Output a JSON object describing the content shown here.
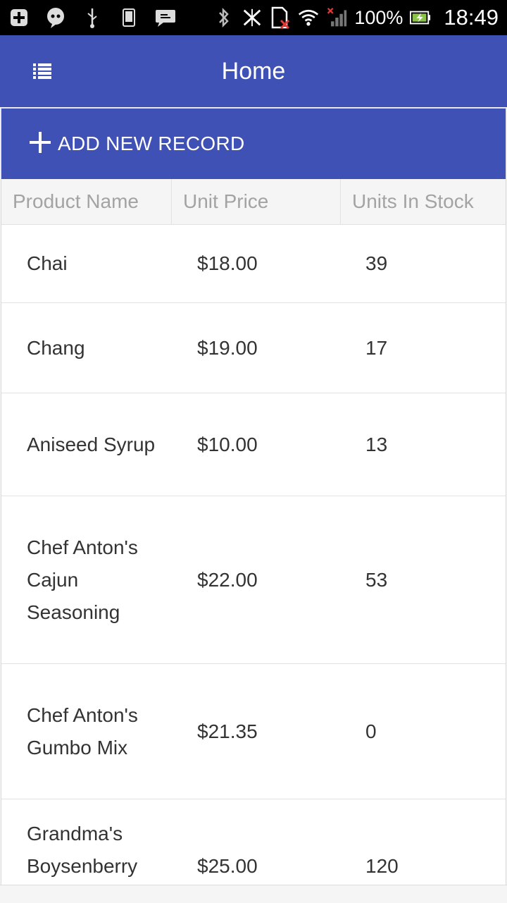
{
  "status_bar": {
    "battery": "100%",
    "time": "18:49",
    "icons": [
      "add-icon",
      "chat-icon",
      "usb-icon",
      "phone-icon",
      "message-icon",
      "bluetooth-icon",
      "signal-off-icon",
      "sim-error-icon",
      "wifi-icon",
      "cell-signal-icon",
      "battery-icon"
    ]
  },
  "app_bar": {
    "title": "Home",
    "menu_icon": "list-icon"
  },
  "toolbar": {
    "add_label": "ADD NEW RECORD"
  },
  "table": {
    "columns": [
      "Product Name",
      "Unit Price",
      "Units In Stock"
    ],
    "rows": [
      {
        "name": "Chai",
        "price": "$18.00",
        "stock": "39"
      },
      {
        "name": "Chang",
        "price": "$19.00",
        "stock": "17"
      },
      {
        "name": "Aniseed Syrup",
        "price": "$10.00",
        "stock": "13"
      },
      {
        "name": "Chef Anton's Cajun Seasoning",
        "price": "$22.00",
        "stock": "53"
      },
      {
        "name": "Chef Anton's Gumbo Mix",
        "price": "$21.35",
        "stock": "0"
      },
      {
        "name": "Grandma's Boysenberry",
        "price": "$25.00",
        "stock": "120"
      }
    ]
  },
  "colors": {
    "primary": "#3f51b5",
    "header_bg": "#f5f5f5",
    "header_text": "#a3a3a3",
    "cell_text": "#333333"
  }
}
